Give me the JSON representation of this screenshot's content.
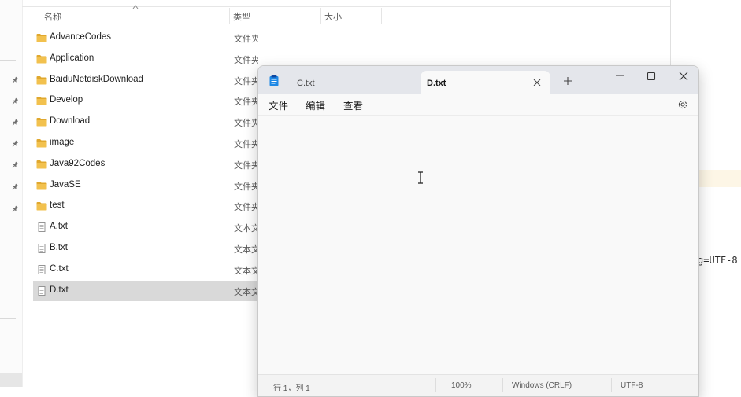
{
  "explorer": {
    "columns": {
      "name": "名称",
      "type": "类型",
      "size": "大小"
    },
    "files": [
      {
        "name": "AdvanceCodes",
        "type": "文件夹",
        "kind": "folder"
      },
      {
        "name": "Application",
        "type": "文件夹",
        "kind": "folder"
      },
      {
        "name": "BaiduNetdiskDownload",
        "type": "文件夹",
        "kind": "folder"
      },
      {
        "name": "Develop",
        "type": "文件夹",
        "kind": "folder"
      },
      {
        "name": "Download",
        "type": "文件夹",
        "kind": "folder"
      },
      {
        "name": "image",
        "type": "文件夹",
        "kind": "folder"
      },
      {
        "name": "Java92Codes",
        "type": "文件夹",
        "kind": "folder"
      },
      {
        "name": "JavaSE",
        "type": "文件夹",
        "kind": "folder"
      },
      {
        "name": "test",
        "type": "文件夹",
        "kind": "folder"
      },
      {
        "name": "A.txt",
        "type": "文本文",
        "kind": "text"
      },
      {
        "name": "B.txt",
        "type": "文本文",
        "kind": "text"
      },
      {
        "name": "C.txt",
        "type": "文本文",
        "kind": "text"
      },
      {
        "name": "D.txt",
        "type": "文本文",
        "kind": "text",
        "selected": true
      }
    ]
  },
  "right_panel": {
    "code_fragment": "g=UTF-8"
  },
  "notepad": {
    "tabs": [
      {
        "label": "C.txt",
        "active": false
      },
      {
        "label": "D.txt",
        "active": true
      }
    ],
    "menu": {
      "file": "文件",
      "edit": "编辑",
      "view": "查看"
    },
    "status": {
      "position": "行 1，列 1",
      "zoom": "100%",
      "line_ending": "Windows (CRLF)",
      "encoding": "UTF-8"
    }
  },
  "colors": {
    "folder": "#f2c14e",
    "folder_dark": "#e0a82e",
    "selection": "#d9d9d9",
    "titlebar": "#e4e6eb",
    "notepad_icon": "#1e88e5"
  },
  "icons": {
    "nav_pins": "pin-icon",
    "app": "notepad-icon",
    "settings": "gear-icon",
    "add_tab": "plus-icon",
    "close_tab": "close-icon"
  }
}
